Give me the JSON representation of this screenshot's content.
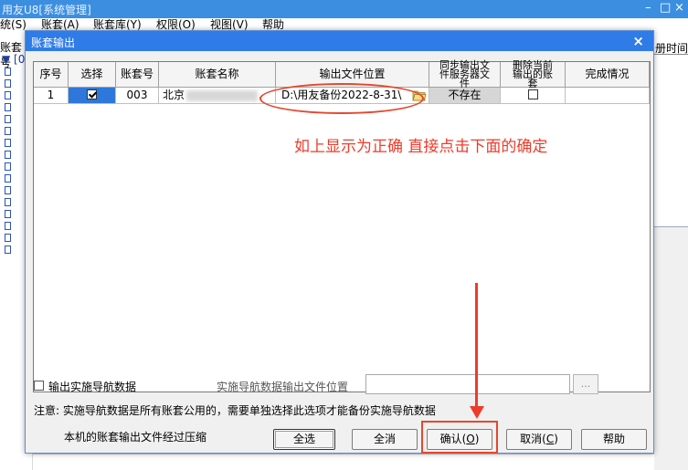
{
  "main_window": {
    "title": "用友U8[系统管理]",
    "controls": [
      "–",
      "□",
      "×"
    ],
    "menu": [
      "统(S)",
      "账套(A)",
      "账套库(Y)",
      "权限(O)",
      "视图(V)",
      "帮助"
    ],
    "tree_label": "账套号",
    "tree_root": "[0",
    "right_column_header": "册时间"
  },
  "dialog": {
    "title": "账套输出",
    "close_glyph": "×",
    "table": {
      "headers": [
        "序号",
        "选择",
        "账套号",
        "账套名称",
        "输出文件位置",
        "同步输出文件服务器文件",
        "删除当前输出的账套",
        "完成情况"
      ],
      "rows": [
        {
          "index": "1",
          "selected": true,
          "account_no": "003",
          "account_name": "北京",
          "output_path": "D:\\用友备份2022-8-31\\",
          "sync_server": "不存在",
          "delete_current": false,
          "status": ""
        }
      ]
    },
    "annotation_text": "如上显示为正确  直接点击下面的确定",
    "export_nav_label": "输出实施导航数据",
    "nav_path_label": "实施导航数据输出文件位置",
    "nav_path_value": "",
    "browse_label": "...",
    "note": "注意: 实施导航数据是所有账套公用的，需要单独选择此选项才能备份实施导航数据",
    "compress_label": "本机的账套输出文件经过压缩",
    "buttons": {
      "select_all": "全选",
      "deselect_all": "全消",
      "confirm": "确认",
      "confirm_key": "O",
      "cancel": "取消",
      "cancel_key": "C",
      "help": "帮助"
    }
  },
  "colors": {
    "titlebar": "#2f7be8",
    "selection": "#2e77db",
    "annotation": "#ef3b2a"
  }
}
